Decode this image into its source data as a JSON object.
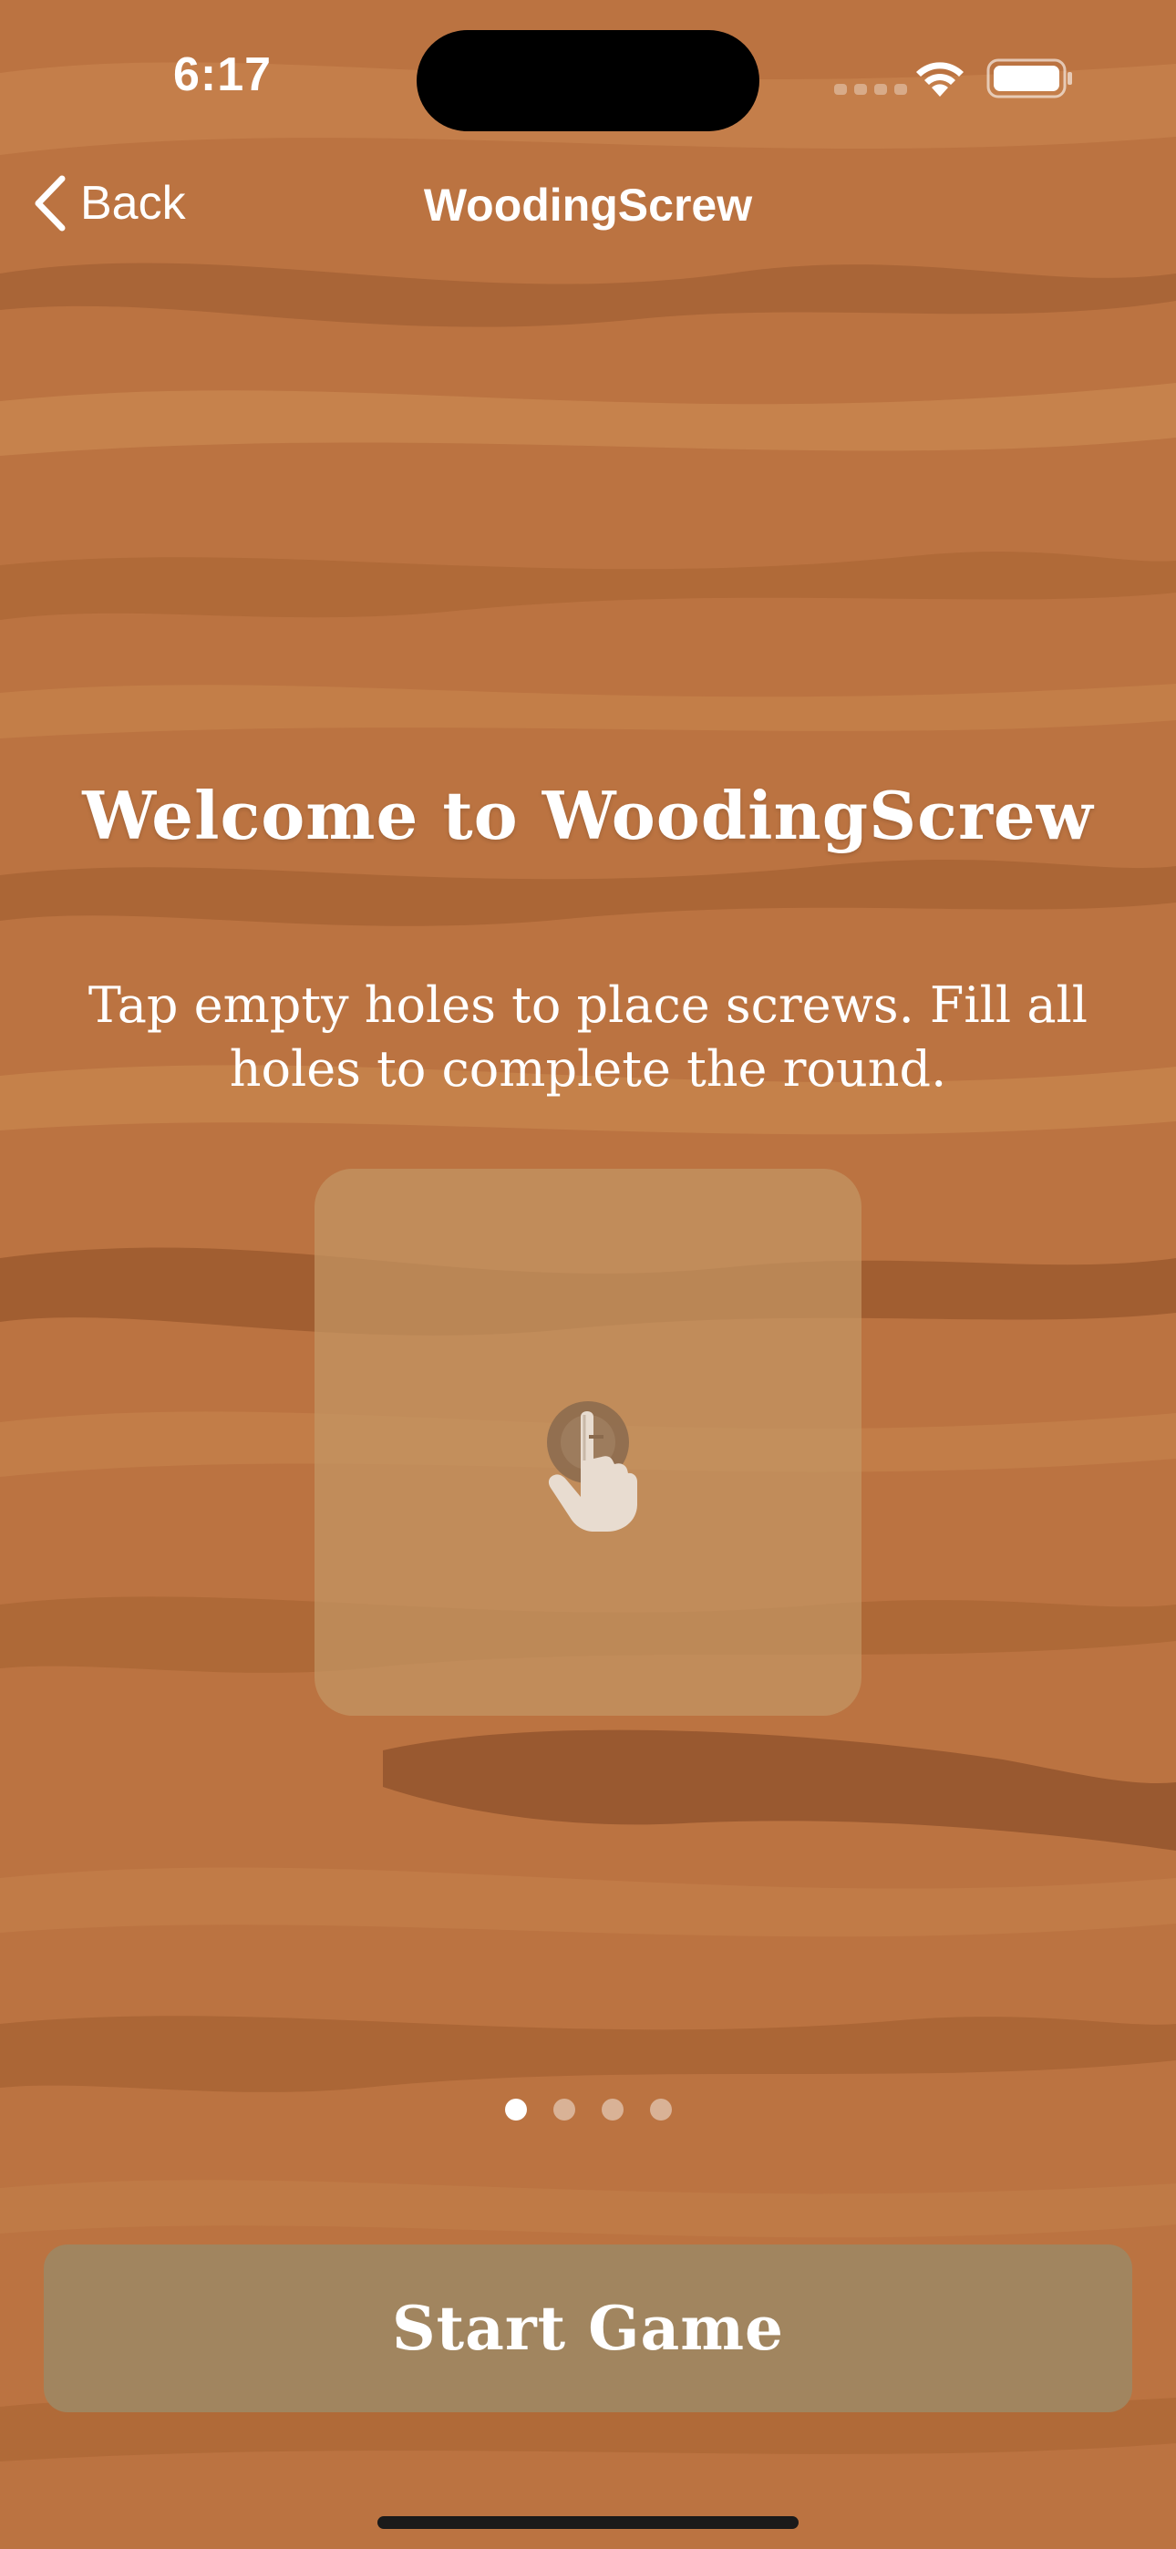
{
  "status_bar": {
    "time": "6:17"
  },
  "nav": {
    "back_label": "Back",
    "title": "WoodingScrew"
  },
  "onboarding": {
    "title": "Welcome to WoodingScrew",
    "instruction_line1": "Tap empty holes to place screws. Fill all",
    "instruction_line2": "holes to complete the round.",
    "demo_icon": "hand-tap-icon",
    "page_count": 4,
    "current_page": 1
  },
  "actions": {
    "start_label": "Start Game"
  },
  "colors": {
    "wood_base": "#b8703f",
    "wood_dark": "#8a4a26",
    "wood_light": "#d08c55",
    "button_fill": "#a1855f",
    "card_fill": "#c49664"
  }
}
